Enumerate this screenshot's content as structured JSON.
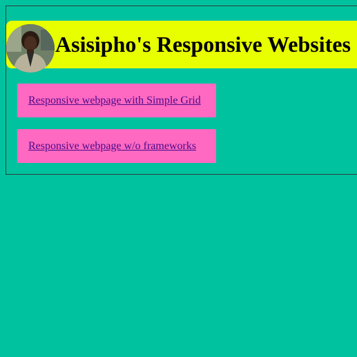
{
  "header": {
    "title": "Asisipho's Responsive Websites",
    "avatar_icon": "person-portrait-icon"
  },
  "links": [
    {
      "label": "Responsive webpage with Simple Grid"
    },
    {
      "label": "Responsive webpage w/o frameworks"
    }
  ],
  "colors": {
    "background": "#00c29f",
    "header": "#e8ff00",
    "card": "#ff69c2",
    "link": "#4b0a8a"
  }
}
